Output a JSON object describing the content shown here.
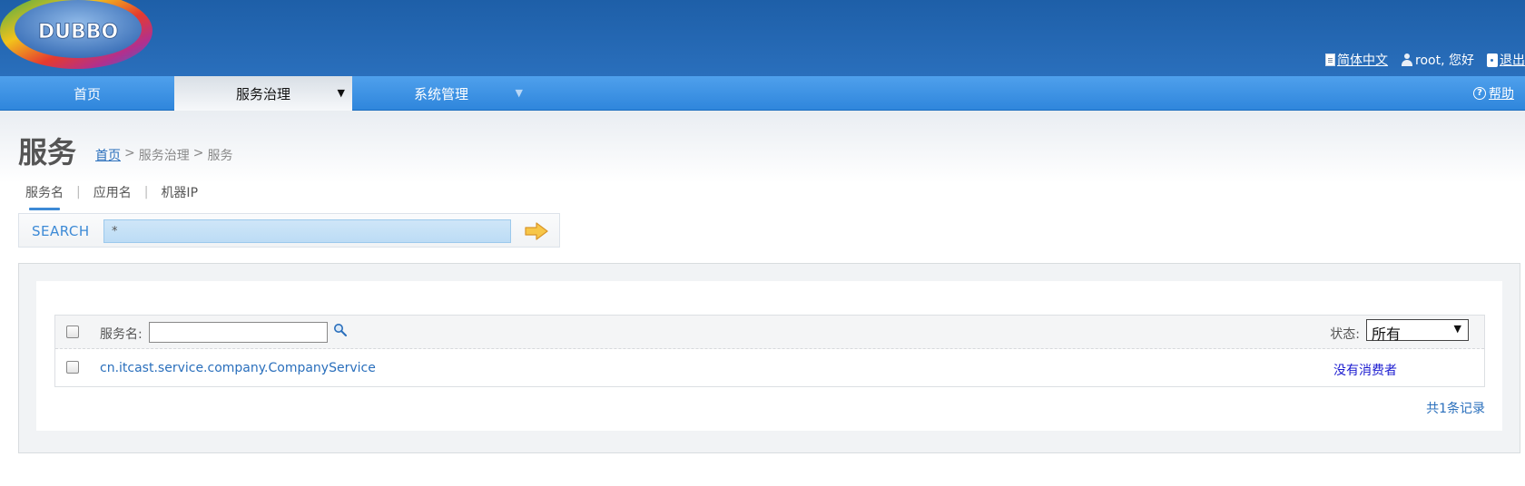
{
  "header": {
    "logo_text": "DUBBO",
    "links": [
      {
        "label": "简体中文",
        "icon": "document-icon"
      },
      {
        "label": "root, 您好",
        "icon": "user-icon"
      },
      {
        "label": "退出",
        "icon": "exit-icon"
      }
    ]
  },
  "nav": {
    "items": [
      {
        "label": "首页"
      },
      {
        "label": "服务治理",
        "active": true
      },
      {
        "label": "系统管理"
      }
    ],
    "help_label": "帮助",
    "help_icon": "question-icon"
  },
  "page": {
    "title": "服务",
    "breadcrumb": {
      "home": "首页",
      "sep1": ">",
      "section": "服务治理",
      "sep2": ">",
      "current": "服务"
    }
  },
  "search": {
    "tabs": [
      {
        "label": "服务名",
        "active": true
      },
      {
        "label": "应用名"
      },
      {
        "label": "机器IP"
      }
    ],
    "separator": "|",
    "label": "SEARCH",
    "value": "*"
  },
  "table": {
    "filter_label": "服务名:",
    "filter_value": "",
    "status_label": "状态:",
    "status_selected": "所有",
    "rows": [
      {
        "service": "cn.itcast.service.company.CompanyService",
        "status": "没有消费者"
      }
    ]
  },
  "footer": {
    "record_count": "共1条记录"
  },
  "colors": {
    "header": "#1e5fa8",
    "nav": "#3d92e4",
    "link": "#2a6fbc",
    "status_link": "#1c1cd0"
  }
}
